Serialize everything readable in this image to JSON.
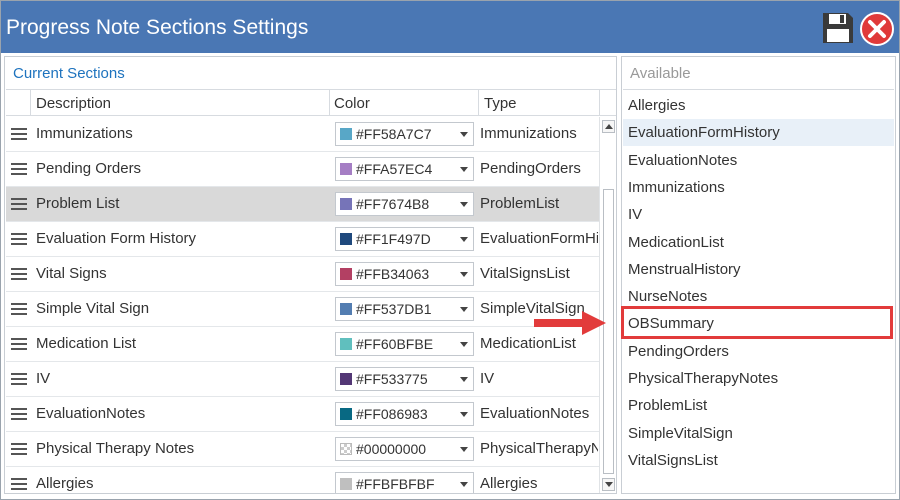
{
  "window": {
    "title": "Progress Note Sections Settings"
  },
  "toolbar": {
    "save_icon": "floppy-disk-icon",
    "close_icon": "close-x-icon"
  },
  "current_sections": {
    "title": "Current Sections",
    "columns": [
      "Description",
      "Color",
      "Type"
    ],
    "rows": [
      {
        "description": "Immunizations",
        "color": "#FF58A7C7",
        "swatch": "#58A7C7",
        "type": "Immunizations"
      },
      {
        "description": "Pending Orders",
        "color": "#FFA57EC4",
        "swatch": "#A57EC4",
        "type": "PendingOrders"
      },
      {
        "description": "Problem List",
        "color": "#FF7674B8",
        "swatch": "#7674B8",
        "type": "ProblemList"
      },
      {
        "description": "Evaluation Form History",
        "color": "#FF1F497D",
        "swatch": "#1F497D",
        "type": "EvaluationFormHistory"
      },
      {
        "description": "Vital Signs",
        "color": "#FFB34063",
        "swatch": "#B34063",
        "type": "VitalSignsList"
      },
      {
        "description": "Simple Vital Sign",
        "color": "#FF537DB1",
        "swatch": "#537DB1",
        "type": "SimpleVitalSign"
      },
      {
        "description": "Medication List",
        "color": "#FF60BFBE",
        "swatch": "#60BFBE",
        "type": "MedicationList"
      },
      {
        "description": "IV",
        "color": "#FF533775",
        "swatch": "#533775",
        "type": "IV"
      },
      {
        "description": "EvaluationNotes",
        "color": "#FF086983",
        "swatch": "#086983",
        "type": "EvaluationNotes"
      },
      {
        "description": "Physical Therapy Notes",
        "color": "#00000000",
        "swatch": "transparent",
        "type": "PhysicalTherapyNotes"
      },
      {
        "description": "Allergies",
        "color": "#FFBFBFBF",
        "swatch": "#BFBFBF",
        "type": "Allergies"
      }
    ],
    "selected_row": 2
  },
  "available": {
    "title": "Available",
    "items": [
      "Allergies",
      "EvaluationFormHistory",
      "EvaluationNotes",
      "Immunizations",
      "IV",
      "MedicationList",
      "MenstrualHistory",
      "NurseNotes",
      "OBSummary",
      "PendingOrders",
      "PhysicalTherapyNotes",
      "ProblemList",
      "SimpleVitalSign",
      "VitalSignsList"
    ],
    "hovered_item": 1,
    "highlighted_item": 8
  },
  "colors": {
    "titlebar": "#4a77b4",
    "accent": "#1e73be",
    "annotation": "#e23b3b",
    "selected_row": "#d9d9d9"
  }
}
